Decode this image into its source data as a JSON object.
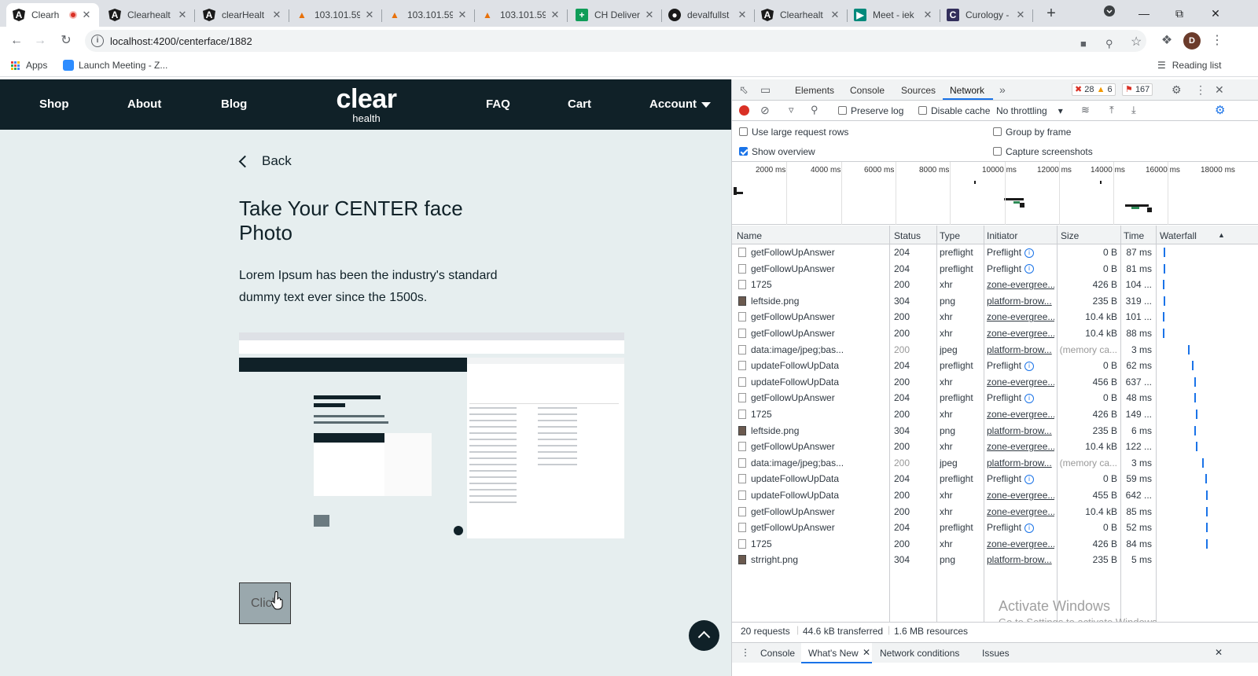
{
  "browser": {
    "tabs": [
      {
        "title": "Clearh",
        "icon": "angular-icon",
        "active": true
      },
      {
        "title": "Clearhealt",
        "icon": "angular-icon"
      },
      {
        "title": "clearHealt",
        "icon": "angular-icon"
      },
      {
        "title": "103.101.59",
        "icon": "pma-icon"
      },
      {
        "title": "103.101.59",
        "icon": "pma-icon"
      },
      {
        "title": "103.101.59",
        "icon": "pma-icon"
      },
      {
        "title": "CH Deliver",
        "icon": "sheets-icon"
      },
      {
        "title": "devalfullst",
        "icon": "github-icon"
      },
      {
        "title": "Clearhealt",
        "icon": "angular-icon"
      },
      {
        "title": "Meet - iek",
        "icon": "meet-icon"
      },
      {
        "title": "Curology -",
        "icon": "curology-icon"
      }
    ],
    "url": "localhost:4200/centerface/1882",
    "avatar_initial": "D",
    "bookmarks": {
      "apps": "Apps",
      "launch": "Launch Meeting - Z...",
      "reading_list": "Reading list"
    }
  },
  "app": {
    "nav": {
      "shop": "Shop",
      "about": "About",
      "blog": "Blog",
      "faq": "FAQ",
      "cart": "Cart",
      "account": "Account"
    },
    "logo": {
      "line1": "clear",
      "line2": "health"
    },
    "back": "Back",
    "heading": "Take Your CENTER face Photo",
    "description": "Lorem Ipsum has been the industry's standard dummy text ever since the 1500s.",
    "capture_button": "Click"
  },
  "devtools": {
    "tabs": [
      "Elements",
      "Console",
      "Sources",
      "Network"
    ],
    "active_tab": "Network",
    "errors": "28",
    "warnings": "6",
    "issues": "167",
    "toolbar": {
      "preserve_log": "Preserve log",
      "disable_cache": "Disable cache",
      "throttling": "No throttling"
    },
    "settings": {
      "large_rows": "Use large request rows",
      "group_frame": "Group by frame",
      "show_overview": "Show overview",
      "capture_screens": "Capture screenshots"
    },
    "overview_ticks": [
      "2000 ms",
      "4000 ms",
      "6000 ms",
      "8000 ms",
      "10000 ms",
      "12000 ms",
      "14000 ms",
      "16000 ms",
      "18000 ms"
    ],
    "columns": {
      "name": "Name",
      "status": "Status",
      "type": "Type",
      "initiator": "Initiator",
      "size": "Size",
      "time": "Time",
      "waterfall": "Waterfall"
    },
    "requests": [
      {
        "name": "getFollowUpAnswer",
        "status": "204",
        "type": "preflight",
        "initiator": "Preflight",
        "size": "0 B",
        "time": "87 ms",
        "kind": "doc",
        "pf": true,
        "wf": 6
      },
      {
        "name": "getFollowUpAnswer",
        "status": "204",
        "type": "preflight",
        "initiator": "Preflight",
        "size": "0 B",
        "time": "81 ms",
        "kind": "doc",
        "pf": true,
        "wf": 6
      },
      {
        "name": "1725",
        "status": "200",
        "type": "xhr",
        "initiator": "zone-evergree...",
        "size": "426 B",
        "time": "104 ...",
        "kind": "doc",
        "link": true,
        "wf": 5
      },
      {
        "name": "leftside.png",
        "status": "304",
        "type": "png",
        "initiator": "platform-brow...",
        "size": "235 B",
        "time": "319 ...",
        "kind": "img",
        "link": true,
        "wf": 7
      },
      {
        "name": "getFollowUpAnswer",
        "status": "200",
        "type": "xhr",
        "initiator": "zone-evergree...",
        "size": "10.4 kB",
        "time": "101 ...",
        "kind": "doc",
        "link": true,
        "wf": 5
      },
      {
        "name": "getFollowUpAnswer",
        "status": "200",
        "type": "xhr",
        "initiator": "zone-evergree...",
        "size": "10.4 kB",
        "time": "88 ms",
        "kind": "doc",
        "link": true,
        "wf": 5
      },
      {
        "name": "data:image/jpeg;bas...",
        "status": "200",
        "type": "jpeg",
        "initiator": "platform-brow...",
        "size": "(memory ca...",
        "time": "3 ms",
        "kind": "doc",
        "link": true,
        "gray": true,
        "wf": 48
      },
      {
        "name": "updateFollowUpData",
        "status": "204",
        "type": "preflight",
        "initiator": "Preflight",
        "size": "0 B",
        "time": "62 ms",
        "kind": "doc",
        "pf": true,
        "wf": 54
      },
      {
        "name": "updateFollowUpData",
        "status": "200",
        "type": "xhr",
        "initiator": "zone-evergree...",
        "size": "456 B",
        "time": "637 ...",
        "kind": "doc",
        "link": true,
        "wf": 58
      },
      {
        "name": "getFollowUpAnswer",
        "status": "204",
        "type": "preflight",
        "initiator": "Preflight",
        "size": "0 B",
        "time": "48 ms",
        "kind": "doc",
        "pf": true,
        "wf": 58
      },
      {
        "name": "1725",
        "status": "200",
        "type": "xhr",
        "initiator": "zone-evergree...",
        "size": "426 B",
        "time": "149 ...",
        "kind": "doc",
        "link": true,
        "wf": 60
      },
      {
        "name": "leftside.png",
        "status": "304",
        "type": "png",
        "initiator": "platform-brow...",
        "size": "235 B",
        "time": "6 ms",
        "kind": "img",
        "link": true,
        "wf": 58
      },
      {
        "name": "getFollowUpAnswer",
        "status": "200",
        "type": "xhr",
        "initiator": "zone-evergree...",
        "size": "10.4 kB",
        "time": "122 ...",
        "kind": "doc",
        "link": true,
        "wf": 60
      },
      {
        "name": "data:image/jpeg;bas...",
        "status": "200",
        "type": "jpeg",
        "initiator": "platform-brow...",
        "size": "(memory ca...",
        "time": "3 ms",
        "kind": "doc",
        "link": true,
        "gray": true,
        "wf": 71
      },
      {
        "name": "updateFollowUpData",
        "status": "204",
        "type": "preflight",
        "initiator": "Preflight",
        "size": "0 B",
        "time": "59 ms",
        "kind": "doc",
        "pf": true,
        "wf": 76
      },
      {
        "name": "updateFollowUpData",
        "status": "200",
        "type": "xhr",
        "initiator": "zone-evergree...",
        "size": "455 B",
        "time": "642 ...",
        "kind": "doc",
        "link": true,
        "wf": 77
      },
      {
        "name": "getFollowUpAnswer",
        "status": "200",
        "type": "xhr",
        "initiator": "zone-evergree...",
        "size": "10.4 kB",
        "time": "85 ms",
        "kind": "doc",
        "link": true,
        "wf": 78
      },
      {
        "name": "getFollowUpAnswer",
        "status": "204",
        "type": "preflight",
        "initiator": "Preflight",
        "size": "0 B",
        "time": "52 ms",
        "kind": "doc",
        "pf": true,
        "wf": 78
      },
      {
        "name": "1725",
        "status": "200",
        "type": "xhr",
        "initiator": "zone-evergree...",
        "size": "426 B",
        "time": "84 ms",
        "kind": "doc",
        "link": true,
        "wf": 78
      },
      {
        "name": "strright.png",
        "status": "304",
        "type": "png",
        "initiator": "platform-brow...",
        "size": "235 B",
        "time": "5 ms",
        "kind": "img",
        "link": true,
        "wf": 0
      }
    ],
    "summary": {
      "requests": "20 requests",
      "transferred": "44.6 kB transferred",
      "resources": "1.6 MB resources"
    },
    "drawer_tabs": {
      "console": "Console",
      "whats_new": "What's New",
      "network_conditions": "Network conditions",
      "issues": "Issues"
    },
    "watermark": {
      "line1": "Activate Windows",
      "line2": "Go to Settings to activate Windows."
    }
  }
}
